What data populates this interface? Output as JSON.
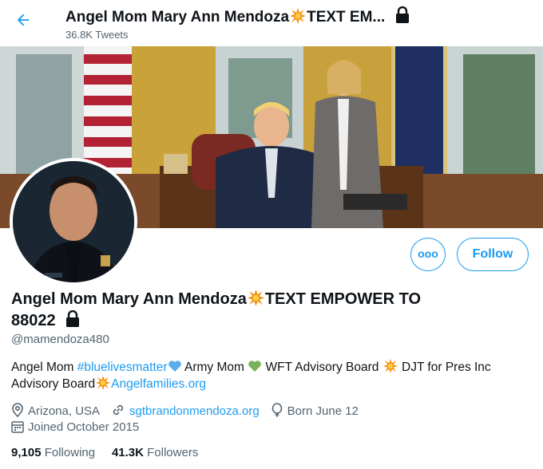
{
  "header": {
    "title": "Angel Mom Mary Ann Mendoza",
    "title_suffix": "TEXT EM...",
    "tweet_count": "36.8K Tweets"
  },
  "actions": {
    "more_label": "ooo",
    "follow_label": "Follow"
  },
  "profile": {
    "name_part1": "Angel Mom Mary Ann Mendoza",
    "name_part2": "TEXT EMPOWER TO",
    "name_part3": "88022",
    "handle": "@mamendoza480",
    "bio": {
      "t1": "Angel Mom ",
      "hashtag": "#bluelivesmatter",
      "t2": " Army Mom ",
      "t3": " WFT Advisory Board ",
      "t4": " DJT for Pres Inc Advisory Board",
      "link": "Angelfamilies.org"
    },
    "location": "Arizona, USA",
    "website": "sgtbrandonmendoza.org",
    "born": "Born June 12",
    "joined": "Joined October 2015",
    "following_count": "9,105",
    "following_label": "Following",
    "followers_count": "41.3K",
    "followers_label": "Followers"
  },
  "colors": {
    "accent": "#1d9bf0",
    "secondary_text": "#536471"
  },
  "icons": [
    "back-arrow-icon",
    "lock-icon",
    "collision-emoji-icon",
    "blue-heart-icon",
    "green-heart-icon",
    "location-icon",
    "link-icon",
    "balloon-icon",
    "calendar-icon"
  ]
}
